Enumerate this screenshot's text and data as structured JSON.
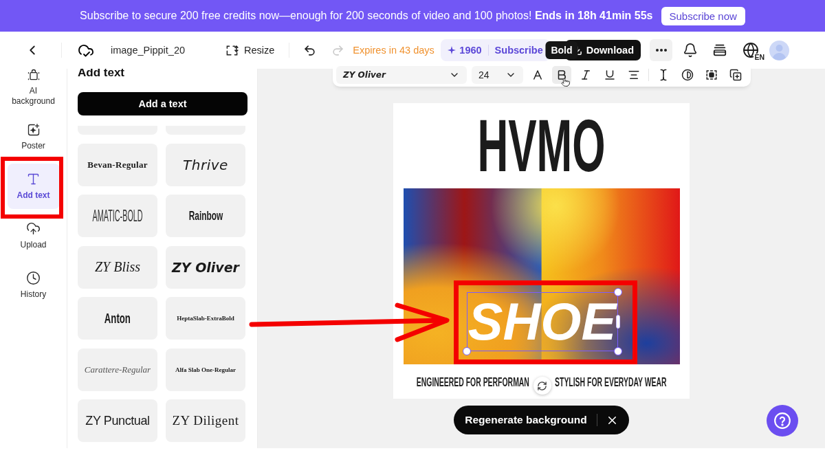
{
  "promo_banner": {
    "message": "Subscribe to secure 200 free credits now—enough for 200 seconds of video and 100 photos! **Ends in 18h 41min 55s**",
    "button": "Subscribe now"
  },
  "header": {
    "project_name": "image_Pippit_20",
    "resize": "Resize",
    "undo_disabled": false,
    "redo_disabled": true,
    "expiry": "Expires in 43 days",
    "credits": "1960",
    "subscribe": "Subscribe",
    "download": "Download",
    "language": "EN"
  },
  "sidebar": {
    "items": [
      {
        "label": "AI background",
        "selected": false
      },
      {
        "label": "Poster",
        "selected": false
      },
      {
        "label": "Add text",
        "selected": true
      },
      {
        "label": "Upload",
        "selected": false
      },
      {
        "label": "History",
        "selected": false
      }
    ]
  },
  "text_panel": {
    "title": "Add text",
    "add_button": "Add a text",
    "fonts": [
      "Bevan-Regular",
      "Thrive",
      "AMATIC-BOLD",
      "Rainbow",
      "ZY Bliss",
      "ZY Oliver",
      "Anton",
      "HeptaSlab-ExtraBold",
      "Carattere-Regular",
      "Alfa Slab One-Regular",
      "ZY Punctual",
      "ZY Diligent"
    ]
  },
  "text_toolbar": {
    "font": "ZY Oliver",
    "size": "24",
    "tooltip": "Bold",
    "tools": [
      {
        "hovered": false
      },
      {
        "hovered": true
      },
      {
        "hovered": false
      },
      {
        "hovered": false
      },
      {
        "hovered": false
      },
      {
        "hovered": false
      },
      {
        "hovered": false
      },
      {
        "hovered": false
      },
      {
        "hovered": false
      }
    ]
  },
  "canvas": {
    "poster": {
      "title": "HVMO",
      "text_box": {
        "text": "SHOE",
        "selected": true
      },
      "subtitle_left": "ENGINEERED FOR PERFORMAN",
      "subtitle_right": "STYLISH FOR EVERYDAY WEAR"
    },
    "regenerate": {
      "label": "Regenerate background"
    }
  }
}
